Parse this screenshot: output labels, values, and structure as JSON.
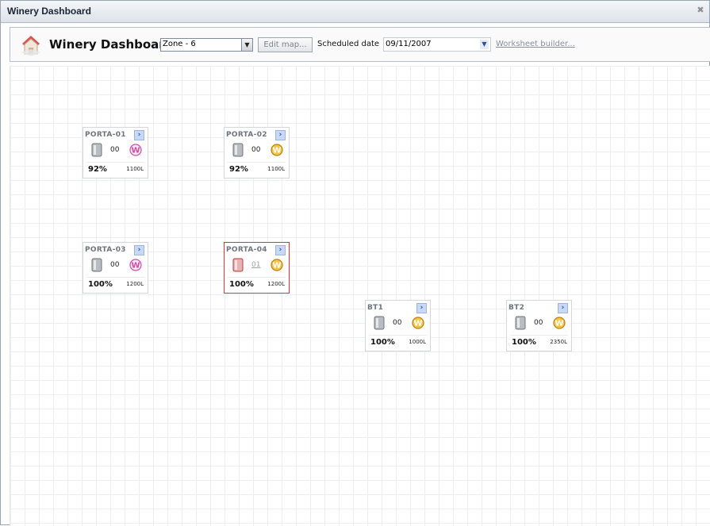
{
  "window": {
    "title": "Winery Dashboard",
    "close_symbol": "✖"
  },
  "toolbar": {
    "app_title": "Winery Dashboard",
    "zone_select_value": "Zone - 6",
    "edit_map_label": "Edit map...",
    "scheduled_date_label": "Scheduled date",
    "scheduled_date_value": "09/11/2007",
    "worksheet_builder_label": "Worksheet builder..."
  },
  "icons": {
    "app": "house-icon",
    "tank": "tank-icon",
    "wine_white": "white-wine-icon",
    "wine_gold": "gold-wine-icon",
    "go": "arrow-right-icon"
  },
  "colors": {
    "selected_border": "#d23a3a",
    "wine_white": "#c94fa6",
    "wine_gold": "#d99b1a",
    "link": "#8a8f96"
  },
  "tanks": [
    {
      "name": "PORTA-01",
      "count": "00",
      "percent": "92%",
      "volume": "1100L",
      "wine": "white",
      "selected": false
    },
    {
      "name": "PORTA-02",
      "count": "00",
      "percent": "92%",
      "volume": "1100L",
      "wine": "gold",
      "selected": false
    },
    {
      "name": "PORTA-03",
      "count": "00",
      "percent": "100%",
      "volume": "1200L",
      "wine": "white",
      "selected": false
    },
    {
      "name": "PORTA-04",
      "count": "01",
      "percent": "100%",
      "volume": "1200L",
      "wine": "gold",
      "selected": true
    },
    {
      "name": "BT1",
      "count": "00",
      "percent": "100%",
      "volume": "1000L",
      "wine": "gold",
      "selected": false
    },
    {
      "name": "BT2",
      "count": "00",
      "percent": "100%",
      "volume": "2350L",
      "wine": "gold",
      "selected": false
    }
  ]
}
